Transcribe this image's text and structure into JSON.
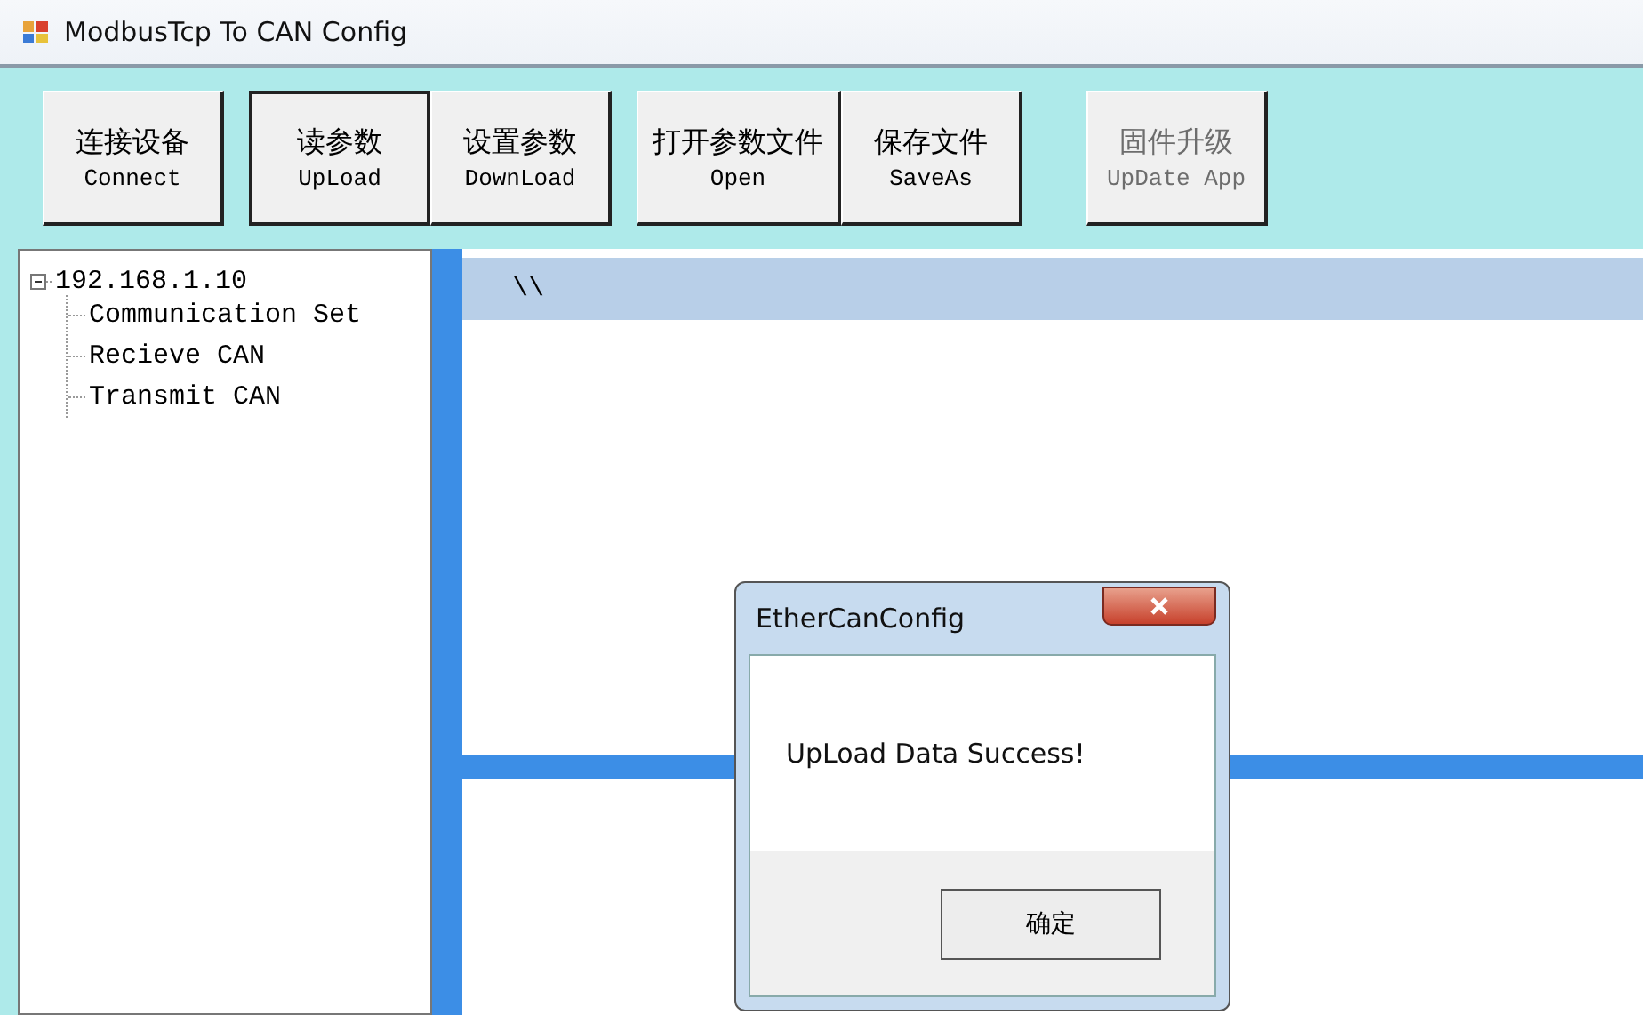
{
  "window": {
    "title": "ModbusTcp To CAN Config"
  },
  "toolbar": [
    {
      "buttons": [
        {
          "label": "连接设备",
          "sublabel": "Connect",
          "pressed": false,
          "disabled": false
        }
      ]
    },
    {
      "buttons": [
        {
          "label": "读参数",
          "sublabel": "UpLoad",
          "pressed": true,
          "disabled": false
        },
        {
          "label": "设置参数",
          "sublabel": "DownLoad",
          "pressed": false,
          "disabled": false
        }
      ]
    },
    {
      "buttons": [
        {
          "label": "打开参数文件",
          "sublabel": "Open",
          "pressed": false,
          "disabled": false
        },
        {
          "label": "保存文件",
          "sublabel": "SaveAs",
          "pressed": false,
          "disabled": false
        }
      ]
    },
    {
      "buttons": [
        {
          "label": "固件升级",
          "sublabel": "UpDate App",
          "pressed": false,
          "disabled": true
        }
      ]
    }
  ],
  "tree": [
    {
      "label": "192.168.1.10",
      "expanded": true,
      "children": [
        {
          "label": "Communication Set"
        },
        {
          "label": "Recieve CAN"
        },
        {
          "label": "Transmit CAN"
        }
      ]
    }
  ],
  "content": {
    "path": "\\\\"
  },
  "dialog": {
    "title": "EtherCanConfig",
    "message": "UpLoad Data Success!",
    "buttons": [
      "确定"
    ]
  }
}
